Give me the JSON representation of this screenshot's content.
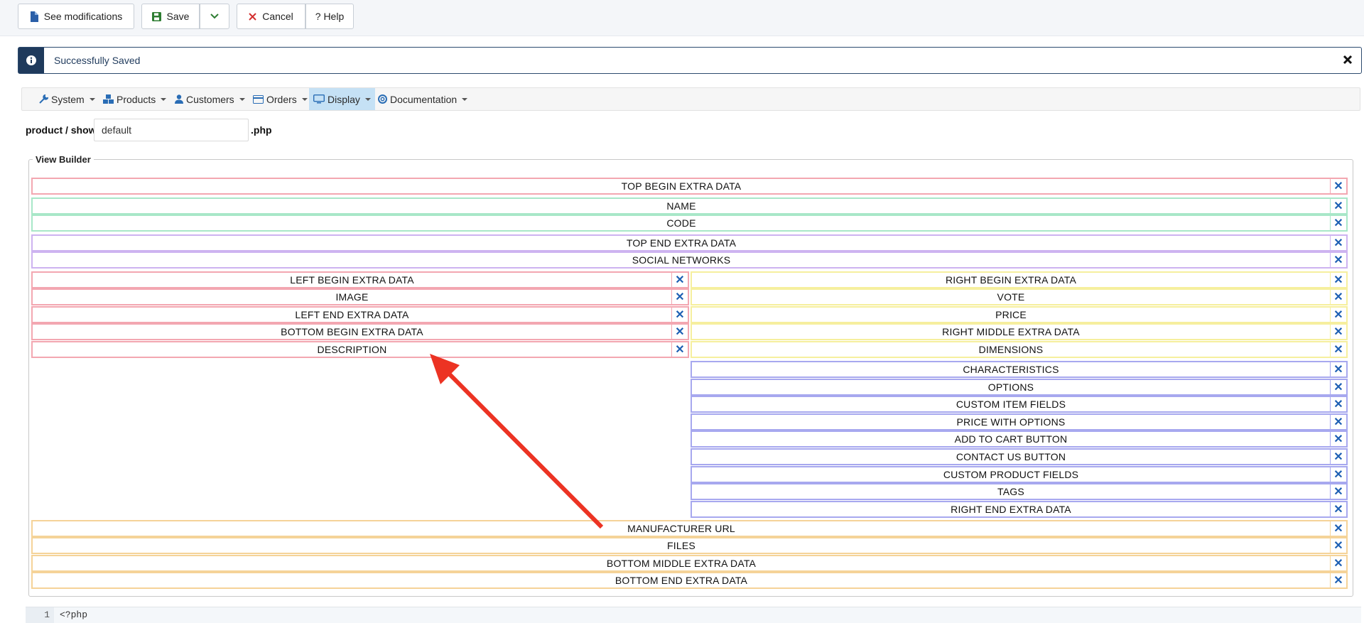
{
  "toolbar": {
    "see_modifications": "See modifications",
    "save": "Save",
    "cancel": "Cancel",
    "help": "? Help"
  },
  "alert": {
    "message": "Successfully Saved"
  },
  "menu": {
    "items": [
      {
        "label": "System",
        "icon": "wrench-icon"
      },
      {
        "label": "Products",
        "icon": "cubes-icon"
      },
      {
        "label": "Customers",
        "icon": "user-icon"
      },
      {
        "label": "Orders",
        "icon": "credit-card-icon"
      },
      {
        "label": "Display",
        "icon": "monitor-icon",
        "active": true
      },
      {
        "label": "Documentation",
        "icon": "lifebuoy-icon"
      }
    ]
  },
  "file": {
    "prefix": "product / show_",
    "value": "default",
    "suffix": ".php"
  },
  "view_builder": {
    "legend": "View Builder",
    "top_rows": [
      "TOP BEGIN EXTRA DATA",
      "NAME",
      "CODE",
      "TOP END EXTRA DATA",
      "SOCIAL NETWORKS"
    ],
    "left_rows": [
      "LEFT BEGIN EXTRA DATA",
      "IMAGE",
      "LEFT END EXTRA DATA",
      "BOTTOM BEGIN EXTRA DATA",
      "DESCRIPTION"
    ],
    "right_rows": [
      "RIGHT BEGIN EXTRA DATA",
      "VOTE",
      "PRICE",
      "RIGHT MIDDLE EXTRA DATA",
      "DIMENSIONS"
    ],
    "right_blue_rows": [
      "CHARACTERISTICS",
      "OPTIONS",
      "CUSTOM ITEM FIELDS",
      "PRICE WITH OPTIONS",
      "ADD TO CART BUTTON",
      "CONTACT US BUTTON",
      "CUSTOM PRODUCT FIELDS",
      "TAGS",
      "RIGHT END EXTRA DATA"
    ],
    "bottom_rows": [
      "MANUFACTURER URL",
      "FILES",
      "BOTTOM MIDDLE EXTRA DATA",
      "BOTTOM END EXTRA DATA"
    ],
    "remove_glyph": "✕"
  },
  "editor": {
    "line_number": "1",
    "code": "<?php"
  },
  "colors": {
    "red": "#f3a7b1",
    "green": "#a8e7c8",
    "purple": "#cdb3f0",
    "yellow": "#f6ef9e",
    "blue": "#a7a8ef",
    "orange": "#f5d398",
    "arrow": "#ec3323",
    "remove": "#1d5fb3"
  }
}
